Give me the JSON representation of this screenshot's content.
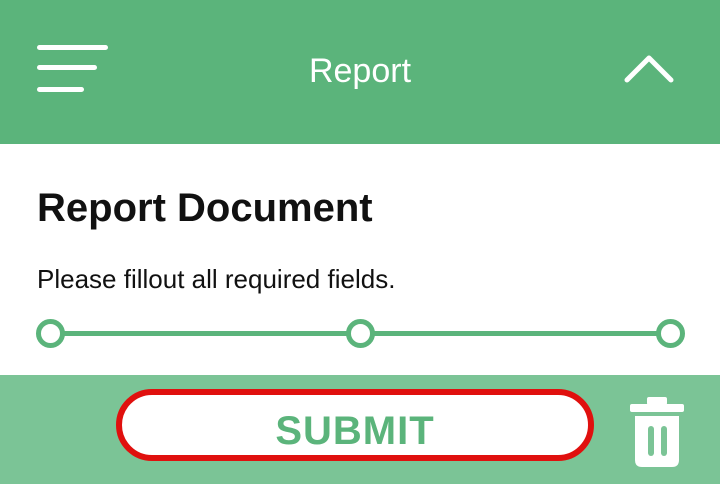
{
  "colors": {
    "header_bg": "#5bb47b",
    "footer_bg": "#7bc496",
    "accent_green": "#5bb47b",
    "submit_border": "#e0100e",
    "text_dark": "#111111",
    "white": "#ffffff"
  },
  "header": {
    "title": "Report",
    "menu_icon": "hamburger-menu-icon",
    "collapse_icon": "chevron-up-icon"
  },
  "content": {
    "heading": "Report Document",
    "instructions": "Please fillout all required fields.",
    "stepper": {
      "step_count": 3
    }
  },
  "footer": {
    "submit_label": "SUBMIT",
    "delete_icon": "trash-icon"
  }
}
